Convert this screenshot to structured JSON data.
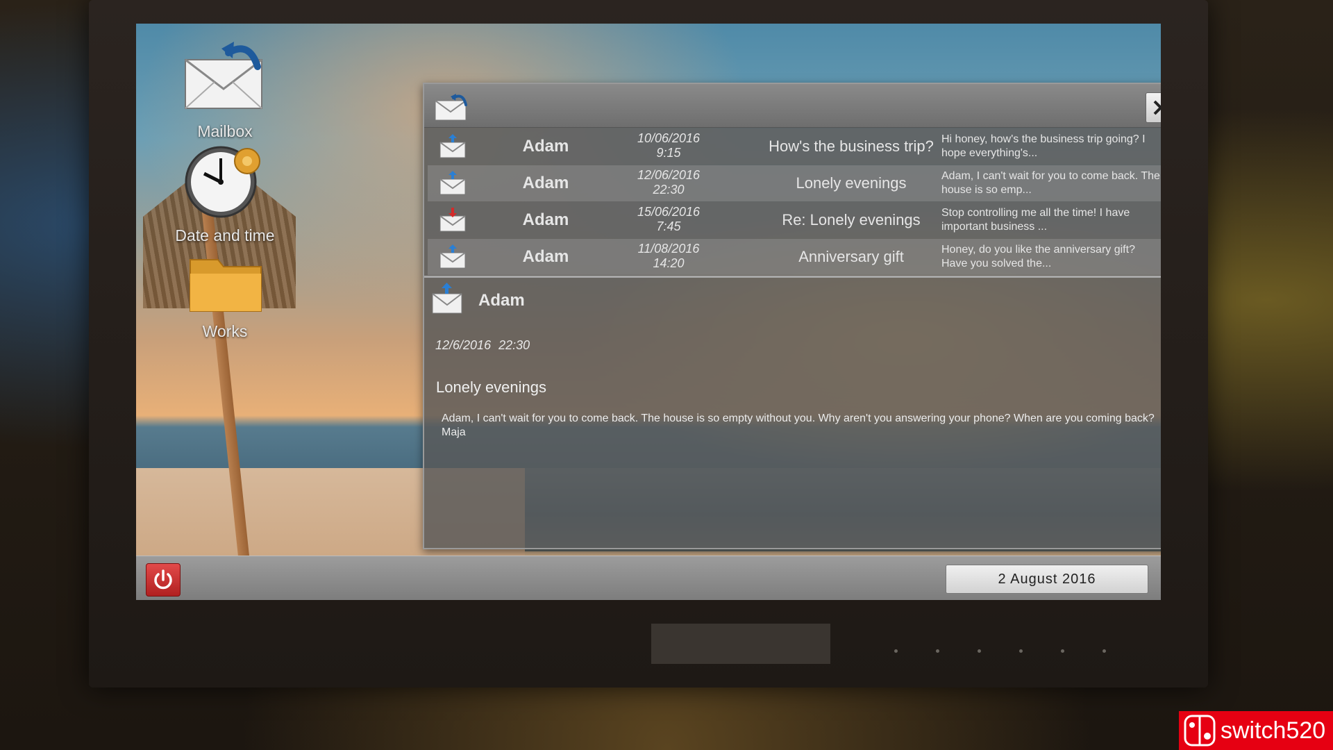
{
  "desktop": {
    "icons": [
      {
        "label": "Mailbox"
      },
      {
        "label": "Date and time"
      },
      {
        "label": "Works"
      }
    ]
  },
  "mail_window": {
    "messages": [
      {
        "from": "Adam",
        "date": "10/06/2016",
        "time": "9:15",
        "subject": "How's the business trip?",
        "preview": "Hi honey, how's the business trip going? I hope everything's...",
        "direction": "incoming"
      },
      {
        "from": "Adam",
        "date": "12/06/2016",
        "time": "22:30",
        "subject": "Lonely evenings",
        "preview": "Adam, I can't wait for you to come back. The house is so emp...",
        "direction": "incoming"
      },
      {
        "from": "Adam",
        "date": "15/06/2016",
        "time": "7:45",
        "subject": "Re: Lonely evenings",
        "preview": "Stop controlling me all the time! I have important business ...",
        "direction": "outgoing"
      },
      {
        "from": "Adam",
        "date": "11/08/2016",
        "time": "14:20",
        "subject": "Anniversary gift",
        "preview": "Honey, do you like the anniversary gift? Have you solved the...",
        "direction": "incoming"
      }
    ],
    "detail": {
      "sender": "Adam",
      "date": "12/6/2016",
      "time": "22:30",
      "subject": "Lonely evenings",
      "body": "Adam, I can't wait for you to come back. The house is so empty without you. Why aren't you answering your phone? When are you coming back? Maja"
    }
  },
  "taskbar": {
    "date": "2 August 2016"
  },
  "watermark": {
    "text": "switch520"
  },
  "colors": {
    "incoming_arrow": "#2a7fd4",
    "outgoing_arrow": "#d42a2a",
    "power": "#d03030",
    "watermark": "#e60012"
  }
}
